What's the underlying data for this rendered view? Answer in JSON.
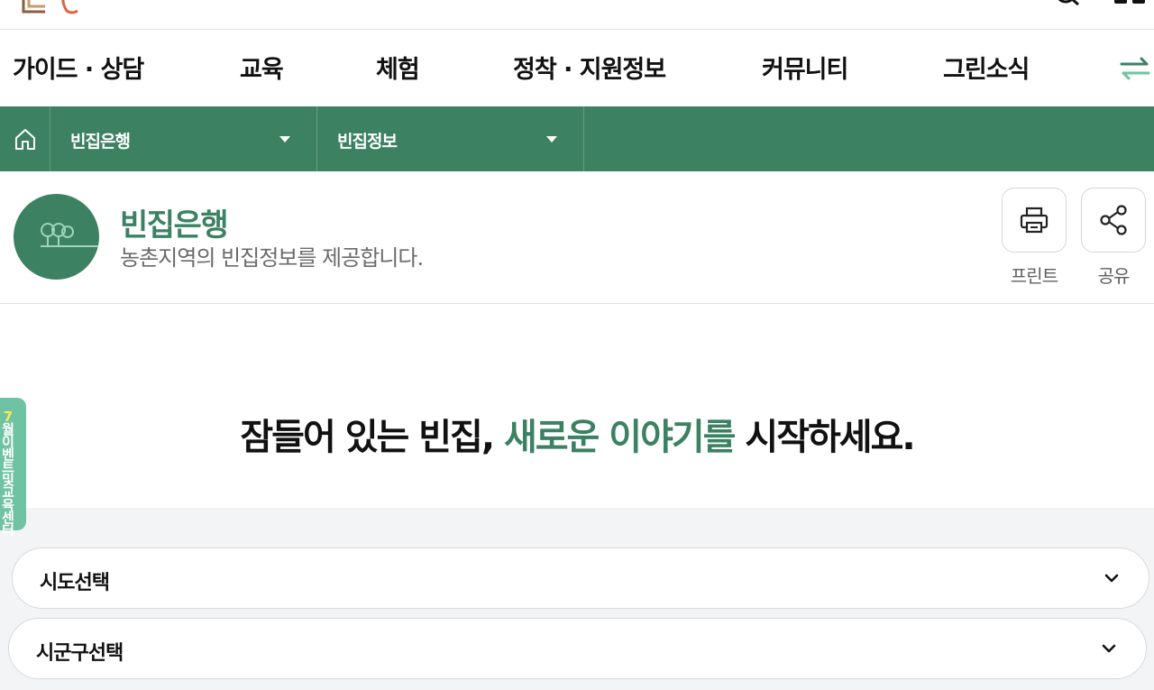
{
  "gnb": {
    "items": [
      "가이드 · 상담",
      "교육",
      "체험",
      "정착 · 지원정보",
      "커뮤니티",
      "그린소식"
    ]
  },
  "location": {
    "depth1": "빈집은행",
    "depth2": "빈집정보"
  },
  "page": {
    "title": "빈집은행",
    "description": "농촌지역의 빈집정보를 제공합니다.",
    "print_label": "프린트",
    "share_label": "공유"
  },
  "headline": {
    "part1": "잠들어 있는 빈집, ",
    "accent": "새로운 이야기를",
    "part2": " 시작하세요."
  },
  "side_tab": {
    "highlight": "7",
    "text": "월 이벤트 및 교육센터"
  },
  "filters": {
    "sido": "시도선택",
    "sigungu": "시군구선택"
  },
  "colors": {
    "brand_green": "#3b8162",
    "side_tab": "#6fc3a3",
    "filter_bg": "#f2f4f6"
  },
  "icons": [
    "logo",
    "search-icon",
    "menu-icon",
    "swap-icon",
    "home-icon",
    "caret-down-icon",
    "print-icon",
    "share-icon",
    "chevron-down-icon"
  ]
}
